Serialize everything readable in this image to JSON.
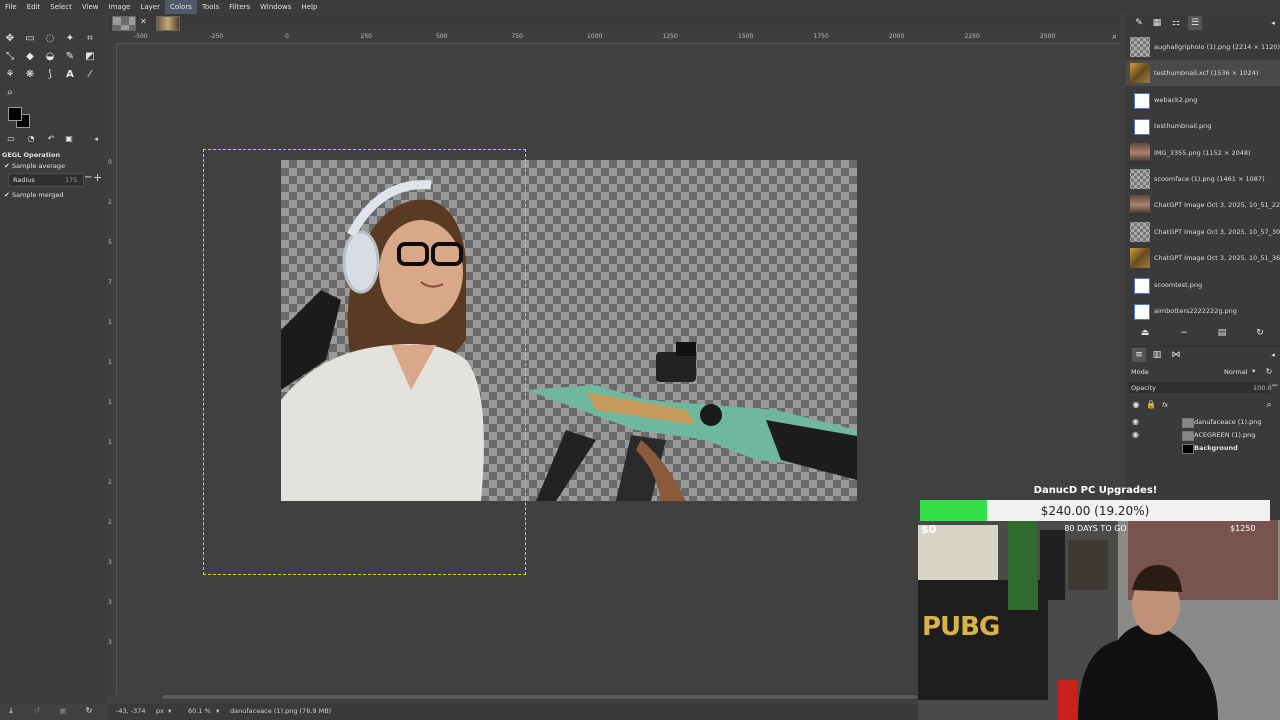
{
  "menu": [
    "File",
    "Edit",
    "Select",
    "View",
    "Image",
    "Layer",
    "Colors",
    "Tools",
    "Filters",
    "Windows",
    "Help"
  ],
  "menu_active": "Colors",
  "rulers": {
    "h_ticks": [
      "-500",
      "-250",
      "0",
      "250",
      "500",
      "750",
      "1000",
      "1250",
      "1500",
      "1750",
      "2000",
      "2250",
      "2500"
    ],
    "v_ticks": [
      "0",
      "2",
      "5",
      "7",
      "1",
      "1",
      "1",
      "1",
      "2",
      "2",
      "3",
      "3",
      "3"
    ]
  },
  "tool_options": {
    "title": "GEGL Operation",
    "sample_average": "Sample average",
    "radius_label": "Radius",
    "radius_value": "175",
    "sample_merged": "Sample merged",
    "minus": "−",
    "plus": "+"
  },
  "images": [
    {
      "name": "aughallgripholo (1).png (2214 × 1120)",
      "thumb": "checker"
    },
    {
      "name": "testhumbnail.xcf (1536 × 1024)",
      "thumb": "photo"
    },
    {
      "name": "weback2.png",
      "thumb": "doc"
    },
    {
      "name": "testhumbnail.png",
      "thumb": "doc"
    },
    {
      "name": "IMG_3355.png (1152 × 2048)",
      "thumb": "portrait"
    },
    {
      "name": "scoomface (1).png (1461 × 1087)",
      "thumb": "checker"
    },
    {
      "name": "ChatGPT Image Oct 3, 2025, 10_51_22 AM",
      "thumb": "portrait"
    },
    {
      "name": "ChatGPT Image Oct 3, 2025, 10_57_30 AM",
      "thumb": "checker"
    },
    {
      "name": "ChatGPT Image Oct 3, 2025, 10_51_36 AM",
      "thumb": "photo"
    },
    {
      "name": "scoomtest.png",
      "thumb": "doc"
    },
    {
      "name": "aimbotters2222222g.png",
      "thumb": "doc"
    }
  ],
  "layers_panel": {
    "mode_label": "Mode",
    "mode_value": "Normal",
    "opacity_label": "Opacity",
    "opacity_value": "100.0",
    "fx": "fx",
    "layers": [
      {
        "name": "danufaceace (1).png",
        "bold": false
      },
      {
        "name": "ACEGREEN (1).png",
        "bold": false
      },
      {
        "name": "Background",
        "bold": true
      }
    ]
  },
  "status": {
    "coords": "-43, -374",
    "unit": "px",
    "zoom": "60.1 %",
    "info": "danufaceace (1).png (76.9 MB)"
  },
  "overlay": {
    "title": "DanucD PC Upgrades!",
    "amount": "$240.00 (19.20%)",
    "progress": 0.192,
    "min": "$0",
    "days": "80 DAYS TO GO",
    "max": "$1250",
    "sign_text": "PUBG"
  },
  "colors": {
    "progress": "#34e04a",
    "selection": "#d6d600",
    "accent": "#4a90d9"
  }
}
